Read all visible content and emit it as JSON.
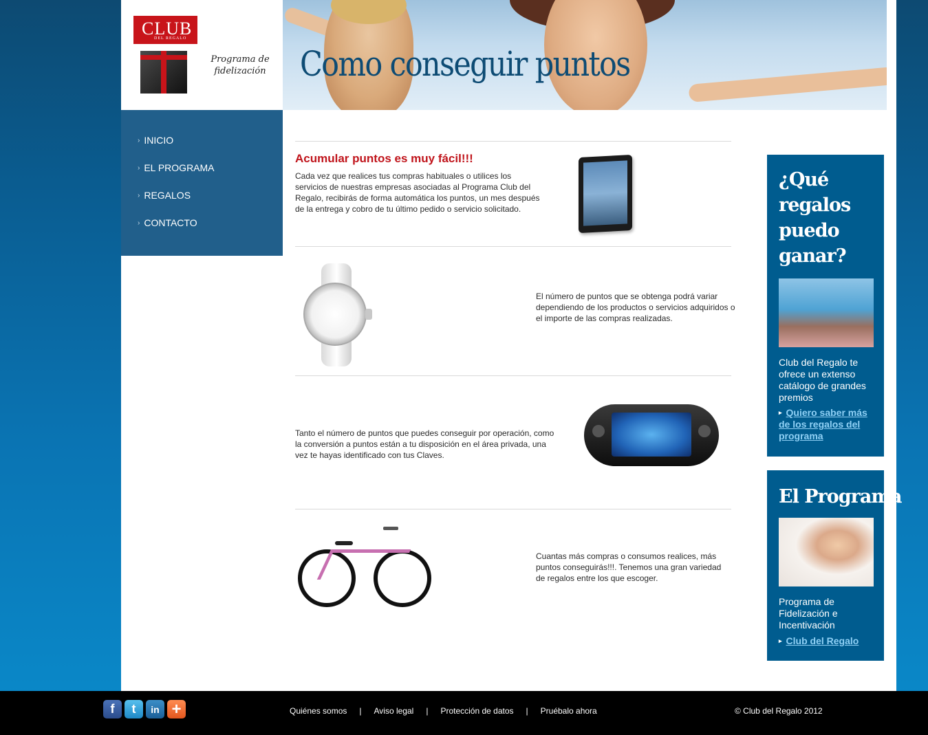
{
  "logo": {
    "club": "CLUB",
    "sub": "DEL REGALO",
    "tagline": "Programa de fidelización"
  },
  "banner": {
    "title": "Como conseguir puntos"
  },
  "nav": {
    "items": [
      "INICIO",
      "EL PROGRAMA",
      "REGALOS",
      "CONTACTO"
    ]
  },
  "content": {
    "headline": "Acumular puntos es muy fácil!!!",
    "p1": "Cada vez que realices tus compras habituales o utilices los servicios de nuestras empresas asociadas al Programa Club del Regalo, recibirás de forma automática los puntos, un mes después de la entrega y cobro de tu último pedido o servicio solicitado.",
    "p2": "El número de puntos que se obtenga podrá variar dependiendo de los productos o servicios adquiridos o el importe de las compras realizadas.",
    "p3": "Tanto el número de puntos que puedes conseguir por operación, como la conversión a puntos están a tu disposición en el área privada, una vez te hayas identificado con tus Claves.",
    "p4": "Cuantas más compras o consumos realices, más puntos conseguirás!!!. Tenemos una gran variedad de regalos entre los que escoger."
  },
  "sidebar": {
    "box1": {
      "title": "¿Qué regalos puedo ganar?",
      "text": "Club del Regalo te ofrece un extenso catálogo de grandes premios",
      "link": "Quiero saber más de los regalos del programa"
    },
    "box2": {
      "title": "El Programa",
      "text": "Programa de Fidelización e Incentivación",
      "link": "Club del Regalo"
    }
  },
  "footer": {
    "links": [
      "Quiénes somos",
      "Aviso legal",
      "Protección de datos",
      "Pruébalo ahora"
    ],
    "separator": "|",
    "copyright": "© Club del Regalo 2012",
    "social": [
      "f",
      "t",
      "in",
      "+"
    ]
  },
  "colors": {
    "brand_red": "#c0141b",
    "nav_blue": "#215f8b",
    "sidebar_blue": "#005c8f",
    "title_blue": "#0d4b74",
    "link_blue": "#8fd0f5"
  },
  "icons": [
    "facebook-icon",
    "twitter-icon",
    "linkedin-icon",
    "addthis-plus-icon",
    "nav-arrow-icon",
    "link-arrow-icon"
  ]
}
